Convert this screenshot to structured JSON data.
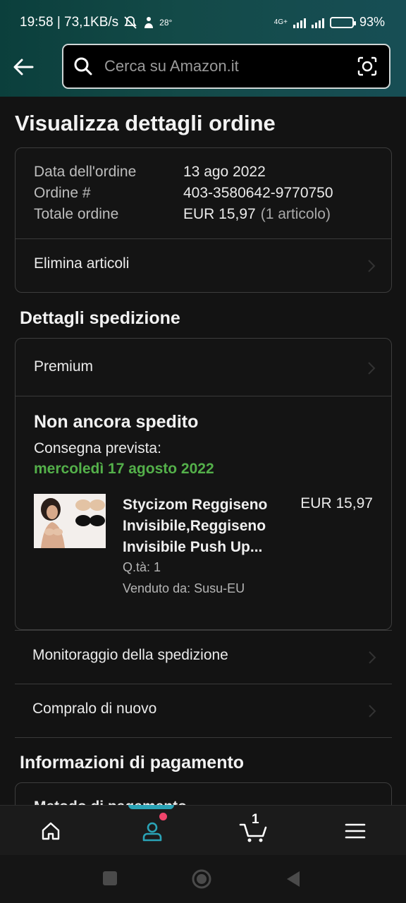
{
  "status_bar": {
    "time_and_speed": "19:58 | 73,1KB/s",
    "temperature": "28°",
    "network": "4G+",
    "battery_percent": "93%",
    "battery_level": 0.93
  },
  "search": {
    "placeholder": "Cerca su Amazon.it"
  },
  "page_title": "Visualizza dettagli ordine",
  "order": {
    "date_label": "Data dell'ordine",
    "date_value": "13 ago 2022",
    "number_label": "Ordine #",
    "number_value": "403-3580642-9770750",
    "total_label": "Totale ordine",
    "total_value": "EUR 15,97",
    "total_items": "(1 articolo)",
    "delete_items": "Elimina articoli"
  },
  "shipping": {
    "section_title": "Dettagli spedizione",
    "speed": "Premium",
    "status": "Non ancora spedito",
    "delivery_label": "Consegna prevista:",
    "delivery_date": "mercoledì 17 agosto 2022",
    "product": {
      "name": "Stycizom Reggiseno Invisibile,Reggiseno Invisibile Push Up...",
      "price": "EUR 15,97",
      "qty": "Q.tà: 1",
      "seller": "Venduto da: Susu-EU"
    },
    "track": "Monitoraggio della spedizione",
    "buy_again": "Compralo di nuovo"
  },
  "payment": {
    "section_title": "Informazioni di pagamento",
    "first_row_partial": "Metodo di pagamento"
  },
  "bottom_nav": {
    "cart_count": "1",
    "items": [
      "home-icon",
      "account-icon",
      "cart-icon",
      "menu-icon"
    ],
    "accent_color": "#2aa3b6"
  },
  "colors": {
    "header_gradient_start": "#0b3f3c",
    "header_gradient_end": "#174e55",
    "delivery_green": "#54b04a",
    "background": "#131313"
  }
}
